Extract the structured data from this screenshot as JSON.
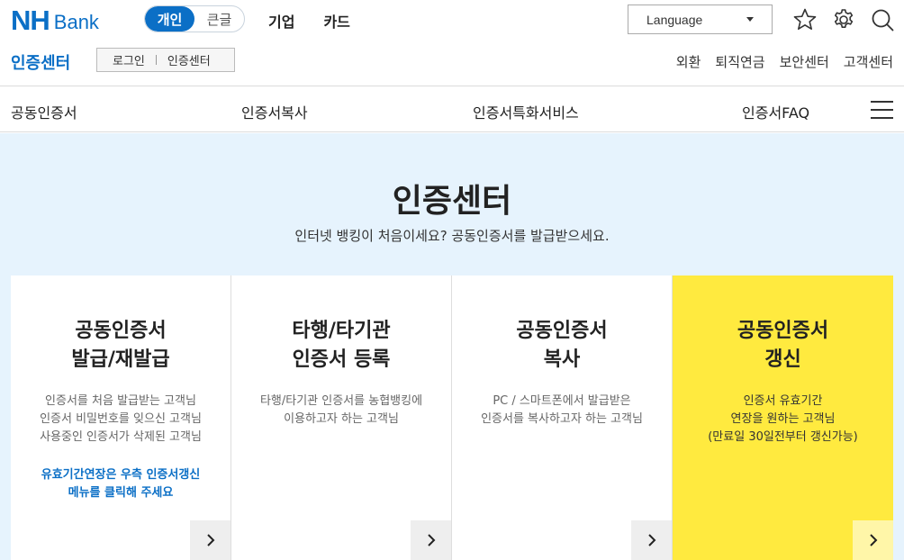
{
  "header": {
    "logo_nh": "NH",
    "logo_bank": "Bank",
    "segments": [
      {
        "label": "개인",
        "active": true
      },
      {
        "label": "큰글",
        "active": false
      }
    ],
    "nav": [
      "기업",
      "카드"
    ],
    "language_label": "Language"
  },
  "subbar": {
    "title": "인증센터",
    "buttons": [
      "로그인",
      "인증센터"
    ],
    "links": [
      "외환",
      "퇴직연금",
      "보안센터",
      "고객센터"
    ]
  },
  "menu": {
    "items": [
      "공동인증서",
      "인증서복사",
      "인증서특화서비스",
      "인증서FAQ"
    ]
  },
  "hero": {
    "title": "인증센터",
    "description": "인터넷 뱅킹이 처음이세요? 공동인증서를 발급받으세요."
  },
  "cards": [
    {
      "title_lines": [
        "공동인증서",
        "발급/재발급"
      ],
      "desc_lines": [
        "인증서를 처음 발급받는 고객님",
        "인증서 비밀번호를 잊으신 고객님",
        "사용중인 인증서가 삭제된 고객님"
      ],
      "note_lines": [
        "유효기간연장은 우측 인증서갱신",
        "메뉴를 클릭해 주세요"
      ]
    },
    {
      "title_lines": [
        "타행/타기관",
        "인증서 등록"
      ],
      "desc_lines": [
        "타행/타기관 인증서를 농협뱅킹에",
        "이용하고자 하는 고객님"
      ]
    },
    {
      "title_lines": [
        "공동인증서",
        "복사"
      ],
      "desc_lines": [
        "PC / 스마트폰에서 발급받은",
        "인증서를 복사하고자 하는 고객님"
      ]
    },
    {
      "title_lines": [
        "공동인증서",
        "갱신"
      ],
      "desc_lines": [
        "인증서 유효기간",
        "연장을 원하는 고객님",
        "(만료일 30일전부터 갱신가능)"
      ]
    }
  ],
  "colors": {
    "brand_blue": "#0b6fc6",
    "hero_bg": "#e6f3fd",
    "highlight_yellow": "#ffea3f"
  }
}
